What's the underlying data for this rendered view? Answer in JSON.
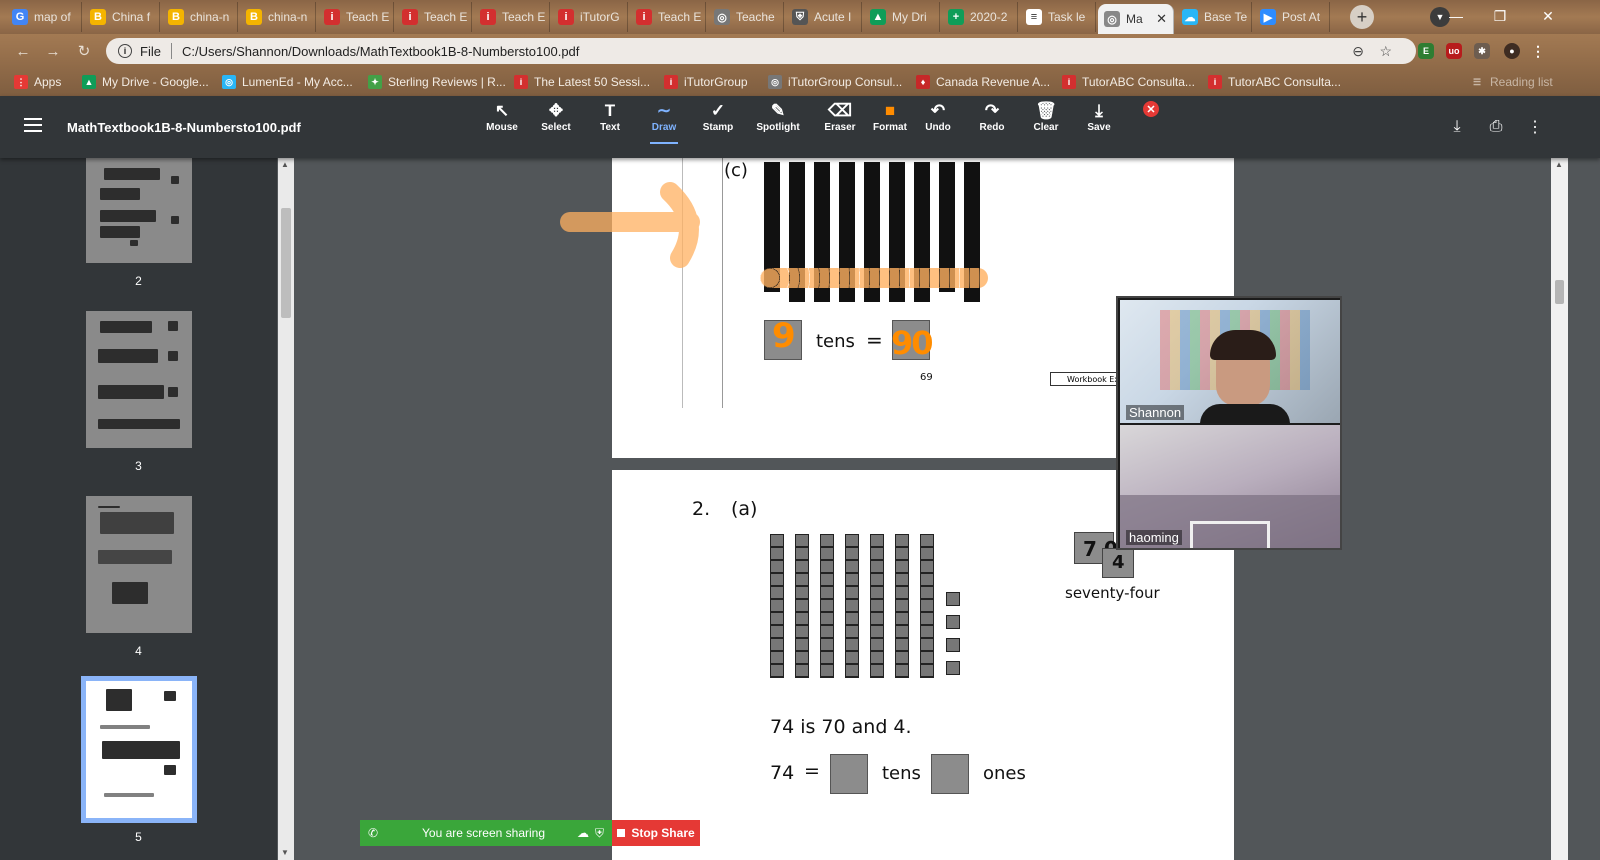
{
  "browser": {
    "tabs": [
      {
        "label": "map of",
        "icon": "google-icon",
        "color": "#4285f4",
        "glyph": "G"
      },
      {
        "label": "China f",
        "icon": "bookmark-app-icon",
        "color": "#f4b400",
        "glyph": "B"
      },
      {
        "label": "china-n",
        "icon": "bookmark-app-icon",
        "color": "#f4b400",
        "glyph": "B"
      },
      {
        "label": "china-n",
        "icon": "bookmark-app-icon",
        "color": "#f4b400",
        "glyph": "B"
      },
      {
        "label": "Teach E",
        "icon": "itutor-icon",
        "color": "#d32f2f",
        "glyph": "i"
      },
      {
        "label": "Teach E",
        "icon": "itutor-icon",
        "color": "#d32f2f",
        "glyph": "i"
      },
      {
        "label": "Teach E",
        "icon": "itutor-icon",
        "color": "#d32f2f",
        "glyph": "i"
      },
      {
        "label": "iTutorG",
        "icon": "itutor-icon",
        "color": "#d32f2f",
        "glyph": "i"
      },
      {
        "label": "Teach E",
        "icon": "itutor-icon",
        "color": "#d32f2f",
        "glyph": "i"
      },
      {
        "label": "Teache",
        "icon": "globe-icon",
        "color": "#777777",
        "glyph": "◎"
      },
      {
        "label": "Acute I",
        "icon": "shield-icon",
        "color": "#555555",
        "glyph": "⛨"
      },
      {
        "label": "My Dri",
        "icon": "drive-icon",
        "color": "#0f9d58",
        "glyph": "▲"
      },
      {
        "label": "2020-2",
        "icon": "sheets-icon",
        "color": "#0f9d58",
        "glyph": "+"
      },
      {
        "label": "Task le",
        "icon": "doc-icon",
        "color": "#ffffff",
        "glyph": "≡"
      },
      {
        "label": "Ma",
        "icon": "globe-icon",
        "color": "#888888",
        "glyph": "◎",
        "active": true
      },
      {
        "label": "Base Te",
        "icon": "cloud-icon",
        "color": "#29b6f6",
        "glyph": "☁"
      },
      {
        "label": "Post At",
        "icon": "zoom-icon",
        "color": "#2d8cff",
        "glyph": "▶"
      }
    ],
    "url_scheme": "File",
    "url": "C:/Users/Shannon/Downloads/MathTextbook1B-8-Numbersto100.pdf",
    "bookmarks": [
      {
        "label": "Apps",
        "color": "#e53935",
        "glyph": "⋮"
      },
      {
        "label": "My Drive - Google...",
        "color": "#0f9d58",
        "glyph": "▲"
      },
      {
        "label": "LumenEd - My Acc...",
        "color": "#29b6f6",
        "glyph": "◎"
      },
      {
        "label": "Sterling Reviews | R...",
        "color": "#43a047",
        "glyph": "✦"
      },
      {
        "label": "The Latest 50 Sessi...",
        "color": "#d32f2f",
        "glyph": "i"
      },
      {
        "label": "iTutorGroup",
        "color": "#d32f2f",
        "glyph": "i"
      },
      {
        "label": "iTutorGroup Consul...",
        "color": "#777777",
        "glyph": "◎"
      },
      {
        "label": "Canada Revenue A...",
        "color": "#c62828",
        "glyph": "♦"
      },
      {
        "label": "TutorABC Consulta...",
        "color": "#d32f2f",
        "glyph": "i"
      },
      {
        "label": "TutorABC Consulta...",
        "color": "#d32f2f",
        "glyph": "i"
      }
    ],
    "reading_list": "Reading list"
  },
  "viewer": {
    "title": "MathTextbook1B-8-Numbersto100.pdf",
    "tools": [
      {
        "label": "Mouse",
        "icon": "cursor-icon",
        "glyph": "↖"
      },
      {
        "label": "Select",
        "icon": "move-icon",
        "glyph": "✥"
      },
      {
        "label": "Text",
        "icon": "text-icon",
        "glyph": "T"
      },
      {
        "label": "Draw",
        "icon": "draw-icon",
        "glyph": "∼",
        "active": true
      },
      {
        "label": "Stamp",
        "icon": "check-icon",
        "glyph": "✓"
      },
      {
        "label": "Spotlight",
        "icon": "spotlight-icon",
        "glyph": "✎"
      },
      {
        "label": "Eraser",
        "icon": "eraser-icon",
        "glyph": "⌫"
      },
      {
        "label": "Format",
        "icon": "format-swatch-icon",
        "glyph": "■"
      },
      {
        "label": "Undo",
        "icon": "undo-icon",
        "glyph": "↶"
      },
      {
        "label": "Redo",
        "icon": "redo-icon",
        "glyph": "↷"
      },
      {
        "label": "Clear",
        "icon": "trash-icon",
        "glyph": "🗑"
      },
      {
        "label": "Save",
        "icon": "save-icon",
        "glyph": "⤓"
      }
    ],
    "thumbnails": [
      {
        "page": "2"
      },
      {
        "page": "3"
      },
      {
        "page": "4"
      },
      {
        "page": "5",
        "current": true
      }
    ]
  },
  "page_upper": {
    "label_c": "(c)",
    "tens_word": "tens",
    "equals": "=",
    "handwritten_tens": "9",
    "handwritten_value": "90",
    "page_number": "69",
    "workbook_label": "Workbook Exer"
  },
  "page_lower": {
    "question_number": "2.",
    "label_a": "(a)",
    "card_tens": "7 0",
    "card_ones": "4",
    "card_words": "seventy-four",
    "sentence": "74 is 70 and 4.",
    "eq_number": "74",
    "eq_equals": "=",
    "eq_tens": "tens",
    "eq_ones": "ones"
  },
  "video": {
    "participants": [
      {
        "name": "Shannon"
      },
      {
        "name": "haoming"
      }
    ]
  },
  "screenshare": {
    "status": "You are screen sharing",
    "stop_label": "Stop Share"
  },
  "colors": {
    "draw_orange": "#ff8c00",
    "share_green": "#3aa63a",
    "stop_red": "#e53935",
    "viewer_dark": "#323639"
  }
}
